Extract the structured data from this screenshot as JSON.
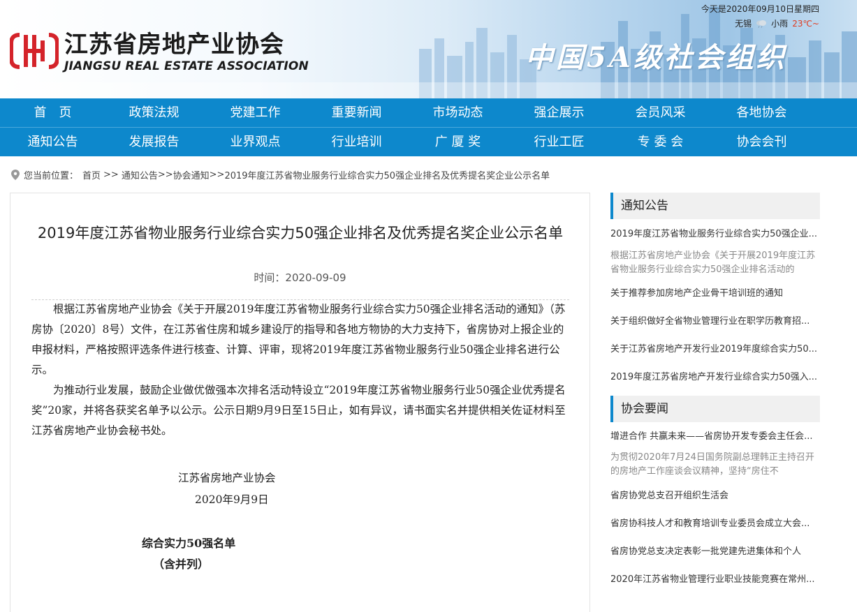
{
  "header": {
    "logo_cn": "江苏省房地产业协会",
    "logo_en": "JIANGSU REAL ESTATE ASSOCIATION",
    "slogan": "中国5A级社会组织",
    "date": "今天是2020年09月10日星期四",
    "city": "无锡",
    "weather": "小雨",
    "temperature": "23℃~"
  },
  "nav": {
    "row1": [
      "首　页",
      "政策法规",
      "党建工作",
      "重要新闻",
      "市场动态",
      "强企展示",
      "会员风采",
      "各地协会"
    ],
    "row2": [
      "通知公告",
      "发展报告",
      "业界观点",
      "行业培训",
      "广 厦 奖",
      "行业工匠",
      "专 委 会",
      "协会会刊"
    ]
  },
  "breadcrumb": {
    "prefix": "您当前位置：",
    "home": "首页",
    "sep1": ">>",
    "notice": "通知公告",
    "sep2": ">>",
    "assoc": "协会通知",
    "sep3": ">>",
    "current": "2019年度江苏省物业服务行业综合实力50强企业排名及优秀提名奖企业公示名单"
  },
  "article": {
    "title": "2019年度江苏省物业服务行业综合实力50强企业排名及优秀提名奖企业公示名单",
    "time": "时间：2020-09-09",
    "para1": "根据江苏省房地产业协会《关于开展2019年度江苏省物业服务行业综合实力50强企业排名活动的通知》（苏房协〔2020〕8号）文件，在江苏省住房和城乡建设厅的指导和各地方物协的大力支持下，省房协对上报企业的申报材料，严格按照评选条件进行核查、计算、评审，现将2019年度江苏省物业服务行业50强企业排名进行公示。",
    "para2": "为推动行业发展，鼓励企业做优做强本次排名活动特设立“2019年度江苏省物业服务行业50强企业优秀提名奖”20家，并将各获奖名单予以公示。公示日期9月9日至15日止，如有异议，请书面实名并提供相关佐证材料至江苏省房地产业协会秘书处。",
    "sign_org": "江苏省房地产业协会",
    "sign_date": "2020年9月9日",
    "list_title": "综合实力50强名单",
    "list_note": "（含并列）"
  },
  "sidebar": {
    "notice_title": "通知公告",
    "notice_items": [
      "2019年度江苏省物业服务行业综合实力50强企业...",
      "根据江苏省房地产业协会《关于开展2019年度江苏省物业服务行业综合实力50强企业排名活动的",
      "关于推荐参加房地产企业骨干培训班的通知",
      "关于组织做好全省物业管理行业在职学历教育招...",
      "关于江苏省房地产开发行业2019年度综合实力50...",
      "2019年度江苏省房地产开发行业综合实力50强入..."
    ],
    "news_title": "协会要闻",
    "news_items": [
      "增进合作 共赢未来——省房协开发专委会主任会...",
      "为贯彻2020年7月24日国务院副总理韩正主持召开的房地产工作座谈会议精神，坚持“房住不",
      "省房协党总支召开组织生活会",
      "省房协科技人才和教育培训专业委员会成立大会...",
      "省房协党总支决定表彰一批党建先进集体和个人",
      "2020年江苏省物业管理行业职业技能竞赛在常州..."
    ]
  },
  "colors": {
    "nav_blue": "#0d88cc",
    "logo_red": "#d4232a",
    "temp_red": "#e03a1e"
  }
}
